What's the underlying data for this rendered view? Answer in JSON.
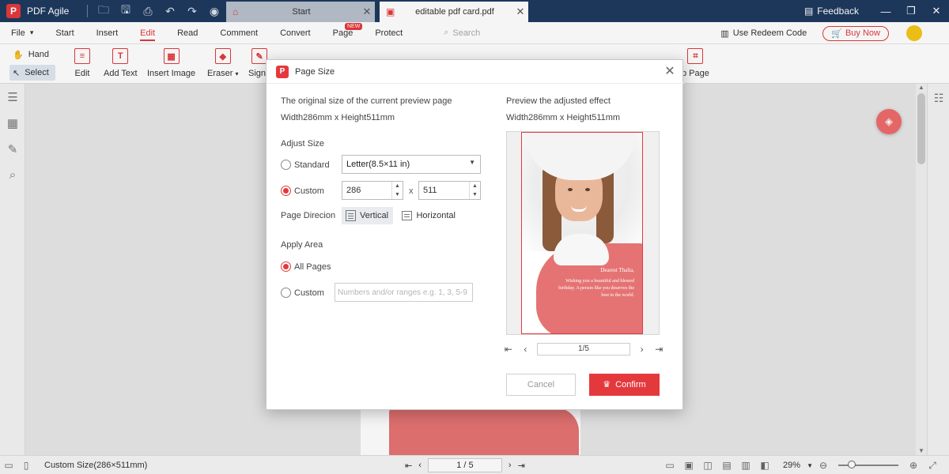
{
  "app": {
    "name": "PDF Agile",
    "logo_letter": "P"
  },
  "tabs": [
    {
      "label": "Start"
    },
    {
      "label": "editable pdf card.pdf"
    }
  ],
  "titlebar": {
    "feedback": "Feedback",
    "min": "—",
    "max": "❐",
    "close": "✕"
  },
  "menu": {
    "items": [
      "File",
      "Start",
      "Insert",
      "Edit",
      "Read",
      "Comment",
      "Convert",
      "Page",
      "Protect"
    ],
    "active": "Edit",
    "file_caret": "▾",
    "new_badge": "NEW",
    "search_placeholder": "Search",
    "redeem": "Use Redeem Code",
    "buy_now": "Buy Now"
  },
  "ribbon": {
    "hand": "Hand",
    "select": "Select",
    "tools": [
      "Edit",
      "Add Text",
      "Insert Image",
      "Eraser",
      "Signa",
      "p Page"
    ],
    "eraser_caret": "▾"
  },
  "dialog": {
    "title": "Page Size",
    "original_label": "The original size of the current preview page",
    "original_size": "Width286mm x Height511mm",
    "preview_label": "Preview the adjusted effect",
    "preview_size": "Width286mm x Height511mm",
    "adjust_size": "Adjust Size",
    "standard": "Standard",
    "standard_selected": false,
    "standard_value": "Letter(8.5×11 in)",
    "custom": "Custom",
    "custom_selected": true,
    "width_value": "286",
    "height_value": "511",
    "times": "x",
    "direction_label": "Page Direcion",
    "vertical": "Vertical",
    "horizontal": "Horizontal",
    "direction_selected": "Vertical",
    "apply_area": "Apply Area",
    "all_pages": "All Pages",
    "all_pages_selected": true,
    "custom_range": "Custom",
    "custom_range_selected": false,
    "range_placeholder": "Numbers and/or ranges e.g. 1, 3, 5-9",
    "preview_greeting": "Dearest Thalia,",
    "preview_message": "Wishing you a beautiful and blessed birthday. A person like you deserves the best in the world.",
    "preview_page": "1/5",
    "cancel": "Cancel",
    "confirm": "Confirm"
  },
  "status": {
    "page_size": "Custom Size(286×511mm)",
    "page": "1 / 5",
    "zoom": "29%",
    "zoom_fraction": 0.29
  },
  "colors": {
    "brand": "#e4393c",
    "titlebar": "#1f3a5f"
  },
  "icons": [
    "pdf-logo-icon",
    "open-folder-icon",
    "save-icon",
    "print-icon",
    "undo-icon",
    "redo-icon",
    "record-icon",
    "home-icon",
    "close-icon",
    "feedback-icon",
    "search-icon",
    "redeem-icon",
    "cart-icon",
    "hand-icon",
    "pointer-icon",
    "thumbnails-icon",
    "bookmarks-icon",
    "annotations-icon",
    "find-icon",
    "settings-icon"
  ]
}
